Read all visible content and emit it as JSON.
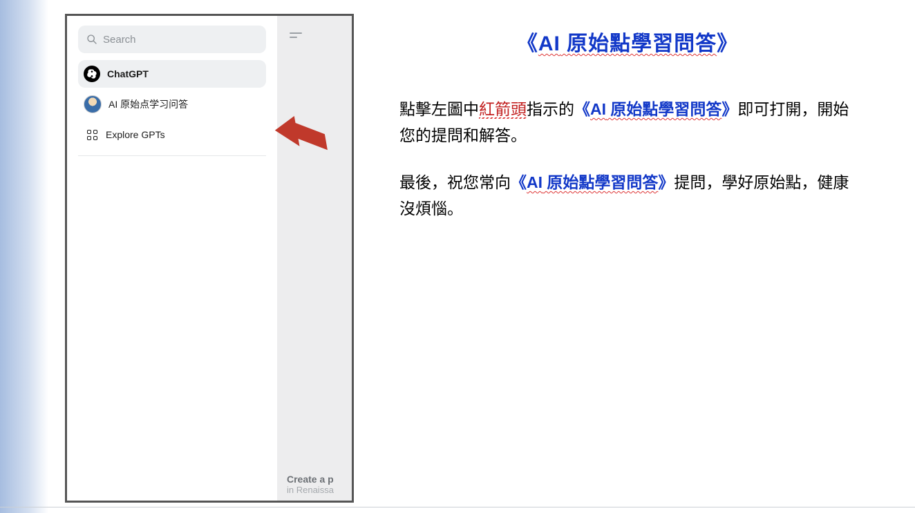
{
  "sidebar": {
    "search_placeholder": "Search",
    "items": [
      {
        "label": "ChatGPT",
        "icon": "chatgpt-logo"
      },
      {
        "label": "AI 原始点学习问答",
        "icon": "avatar"
      },
      {
        "label": "Explore GPTs",
        "icon": "grid"
      }
    ]
  },
  "mainpane": {
    "card_title": "Create a p",
    "card_sub": "in Renaissa"
  },
  "document": {
    "title_open": "《",
    "title_ai": "AI",
    "title_rest": " 原始點學習問答",
    "title_close": "》",
    "p1_a": "點擊左圖中",
    "p1_red": "紅箭頭",
    "p1_b": "指示的",
    "p1_blue_open": "《",
    "p1_blue_ai": "AI",
    "p1_blue_rest": " 原始點學習問答",
    "p1_blue_close": "》",
    "p1_c": "即可打開，開始您的提問和解答。",
    "p2_a": "最後，祝您常向",
    "p2_blue_open": "《",
    "p2_blue_ai": "AI",
    "p2_blue_rest": " 原始點學習問答",
    "p2_blue_close": "》",
    "p2_b": "提問，學好原始點，健康沒煩惱。"
  }
}
